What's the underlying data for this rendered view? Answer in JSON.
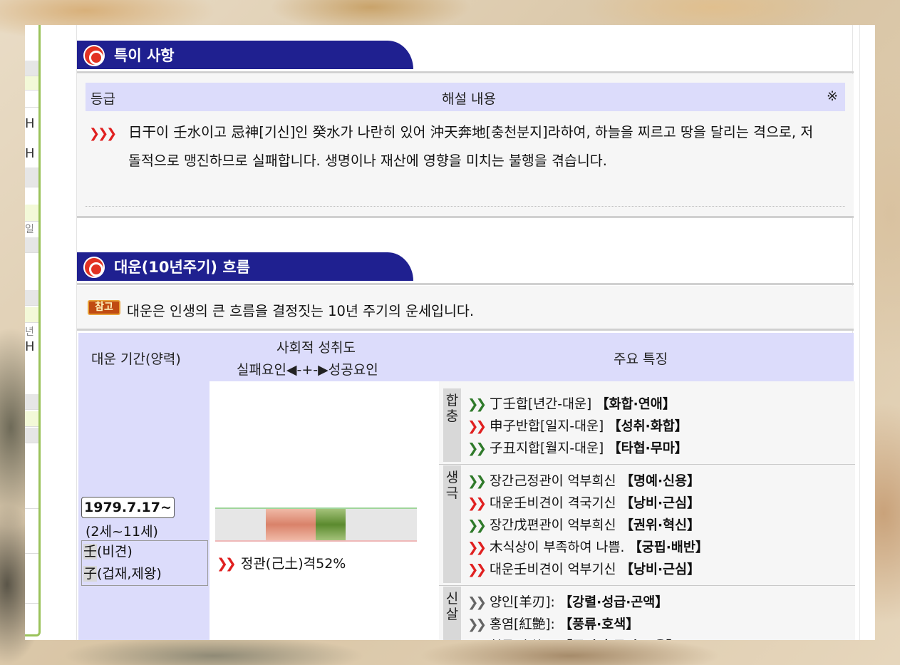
{
  "left_strip": {
    "chars": [
      "H",
      "H",
      "일",
      "년",
      "H"
    ]
  },
  "special": {
    "title": "특이 사항",
    "header": {
      "grade": "등급",
      "content": "해설 내용",
      "mark": "※"
    },
    "text": "日干이 壬水이고 忌神[기신]인 癸水가 나란히 있어 沖天奔地[충천분지]라하여, 하늘을 찌르고 땅을 달리는 격으로, 저돌적으로 맹진하므로 실패합니다. 생명이나 재산에 영향을 미치는 불행을 겪습니다."
  },
  "daeun": {
    "title": "대운(10년주기) 흐름",
    "badge": "참고",
    "note": "대운은 인생의 큰 흐름을 결정짓는 10년 주기의 운세입니다.",
    "table_header": {
      "period": "대운 기간(양력)",
      "achievement_1": "사회적 성취도",
      "achievement_2": "실패요인◀-+-▶성공요인",
      "features": "주요 특징"
    },
    "row": {
      "date": "1979.7.17~",
      "age": "(2세~11세)",
      "stem_char": "壬",
      "stem_desc": "(비견)",
      "branch_char": "子",
      "branch_desc": "(겁재,제왕)",
      "bar_caption": "정관(己土)격52%",
      "achievement_segments": {
        "fail": 0.25,
        "success": 0.15
      },
      "groups": [
        {
          "label": "합충",
          "items": [
            {
              "text": "丁壬합[년간-대운]",
              "kw": "【화합·연애】",
              "arrow": "green"
            },
            {
              "text": "申子반합[일지-대운]",
              "kw": "【성취·화합】",
              "arrow": "red"
            },
            {
              "text": "子丑지합[월지-대운]",
              "kw": "【타협·무마】",
              "arrow": "green"
            }
          ]
        },
        {
          "label": "생극",
          "items": [
            {
              "text": "장간己정관이 억부희신",
              "kw": "【명예·신용】",
              "arrow": "green"
            },
            {
              "text": "대운壬비견이 격국기신",
              "kw": "【낭비·근심】",
              "arrow": "red"
            },
            {
              "text": "장간戊편관이 억부희신",
              "kw": "【권위·혁신】",
              "arrow": "green"
            },
            {
              "text": "木식상이 부족하여 나쁨.",
              "kw": "【궁핍·배반】",
              "arrow": "red"
            },
            {
              "text": "대운壬비견이 억부기신",
              "kw": "【낭비·근심】",
              "arrow": "red"
            }
          ]
        },
        {
          "label": "신살",
          "items": [
            {
              "text": "양인[羊刃]:",
              "kw": "【강렬·성급·곤액】",
              "arrow": "gray"
            },
            {
              "text": "홍염[紅艶]:",
              "kw": "【풍류·호색】",
              "arrow": "gray"
            },
            {
              "text": "협록[夾祿]:",
              "kw": "【주변의 금전 도움】",
              "arrow": "green"
            }
          ]
        }
      ]
    }
  },
  "colors": {
    "header_blue": "#1f2090",
    "table_header": "#dcdcfb",
    "bullet_red": "#e23222",
    "fail_bar": "#d9826a",
    "success_bar": "#5b8a2e"
  }
}
